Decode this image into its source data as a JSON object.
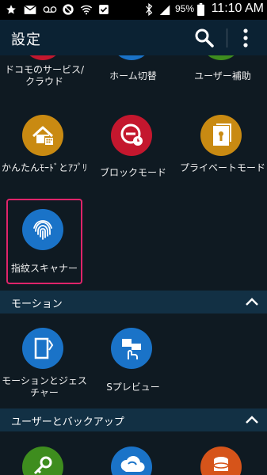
{
  "status_bar": {
    "battery_percent": "95%",
    "time": "11:10 AM",
    "icons": [
      "star-icon",
      "mail-icon",
      "voicemail-icon",
      "call-blocked-icon",
      "wifi-icon",
      "checkbox-icon",
      "bluetooth-icon",
      "signal-icon",
      "battery-icon"
    ]
  },
  "app_bar": {
    "title": "設定",
    "search_icon": "search-icon",
    "more_icon": "more-vert-icon"
  },
  "top_row": [
    {
      "label": "ドコモのサービス/クラウド",
      "color": "#c4172e"
    },
    {
      "label": "ホーム切替",
      "color": "#1a73c8"
    },
    {
      "label": "ユーザー補助",
      "color": "#3e8d1e"
    }
  ],
  "row2": [
    {
      "label": "かんたんﾓｰﾄﾞとｱﾌﾟﾘ",
      "icon": "home-grid-icon",
      "color": "#c98a12"
    },
    {
      "label": "ブロックモード",
      "icon": "block-clock-icon",
      "color": "#c4172e"
    },
    {
      "label": "プライベートモード",
      "icon": "private-folder-icon",
      "color": "#c98a12"
    }
  ],
  "row3": [
    {
      "label": "指紋スキャナー",
      "icon": "fingerprint-icon",
      "color": "#1a73c8",
      "highlighted": true
    }
  ],
  "sections": [
    {
      "title": "モーション",
      "items": [
        {
          "label": "モーションとジェスチャー",
          "icon": "motion-icon",
          "color": "#1a73c8"
        },
        {
          "label": "Sプレビュー",
          "icon": "spreview-icon",
          "color": "#1a73c8"
        }
      ]
    },
    {
      "title": "ユーザーとバックアップ",
      "items": [
        {
          "label": "",
          "icon": "key-icon",
          "color": "#3e8d1e"
        },
        {
          "label": "",
          "icon": "cloud-sync-icon",
          "color": "#1a73c8"
        },
        {
          "label": "",
          "icon": "backup-icon",
          "color": "#d6541a"
        }
      ]
    }
  ]
}
